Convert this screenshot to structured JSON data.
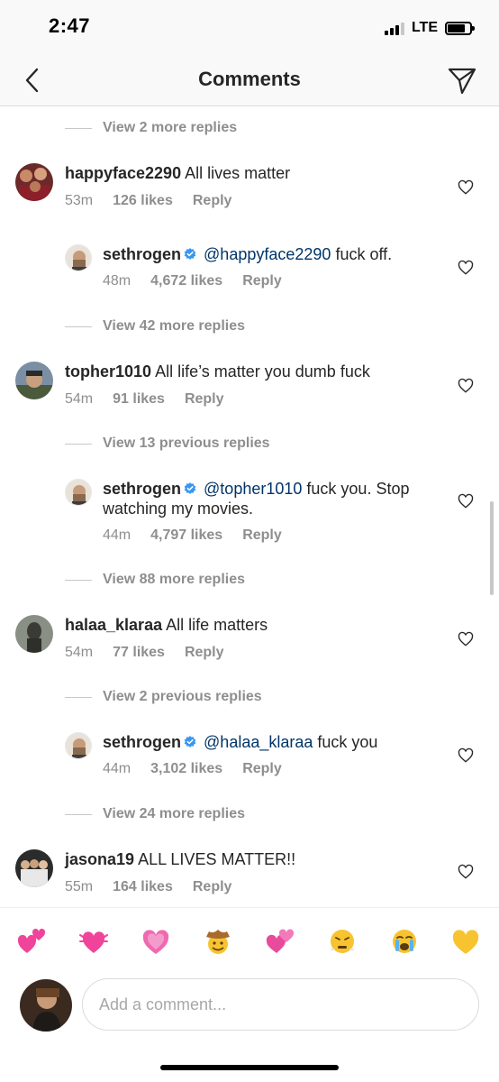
{
  "status_bar": {
    "time": "2:47",
    "network": "LTE",
    "signal_bars_active": 3,
    "signal_bars_total": 4,
    "battery_level": 0.8
  },
  "header": {
    "title": "Comments",
    "back_icon": "chevron-left-icon",
    "share_icon": "paper-plane-icon"
  },
  "view_more": [
    {
      "text": "View 2 more replies"
    },
    {
      "text": "View 42 more replies"
    },
    {
      "text": "View 13 previous replies"
    },
    {
      "text": "View 88 more replies"
    },
    {
      "text": "View 2 previous replies"
    },
    {
      "text": "View 24 more replies"
    }
  ],
  "comments": [
    {
      "username": "happyface2290",
      "text": "All lives matter",
      "time": "53m",
      "likes": "126 likes",
      "reply": "Reply",
      "verified": false,
      "mention": ""
    },
    {
      "username": "sethrogen",
      "mention": "@happyface2290",
      "text": "fuck off.",
      "time": "48m",
      "likes": "4,672 likes",
      "reply": "Reply",
      "verified": true
    },
    {
      "username": "topher1010",
      "text": "All life’s matter you dumb fuck",
      "time": "54m",
      "likes": "91 likes",
      "reply": "Reply",
      "verified": false,
      "mention": ""
    },
    {
      "username": "sethrogen",
      "mention": "@topher1010",
      "text": "fuck you. Stop",
      "text_line2": "watching my movies.",
      "time": "44m",
      "likes": "4,797 likes",
      "reply": "Reply",
      "verified": true
    },
    {
      "username": "halaa_klaraa",
      "text": "All life matters",
      "time": "54m",
      "likes": "77 likes",
      "reply": "Reply",
      "verified": false,
      "mention": ""
    },
    {
      "username": "sethrogen",
      "mention": "@halaa_klaraa",
      "text": "fuck you",
      "time": "44m",
      "likes": "3,102 likes",
      "reply": "Reply",
      "verified": true
    },
    {
      "username": "jasona19",
      "text": "ALL LIVES MATTER!!",
      "time": "55m",
      "likes": "164 likes",
      "reply": "Reply",
      "verified": false,
      "mention": ""
    }
  ],
  "emoji_bar": [
    "two-hearts-icon",
    "beating-heart-icon",
    "growing-heart-icon",
    "cowboy-face-icon",
    "revolving-hearts-icon",
    "steam-face-icon",
    "crying-face-icon",
    "yellow-heart-icon"
  ],
  "composer": {
    "placeholder": "Add a comment..."
  },
  "colors": {
    "text": "#262626",
    "muted": "#8e8e8e",
    "mention": "#003569",
    "verified": "#3897f0",
    "separator": "#dbdbdb"
  }
}
